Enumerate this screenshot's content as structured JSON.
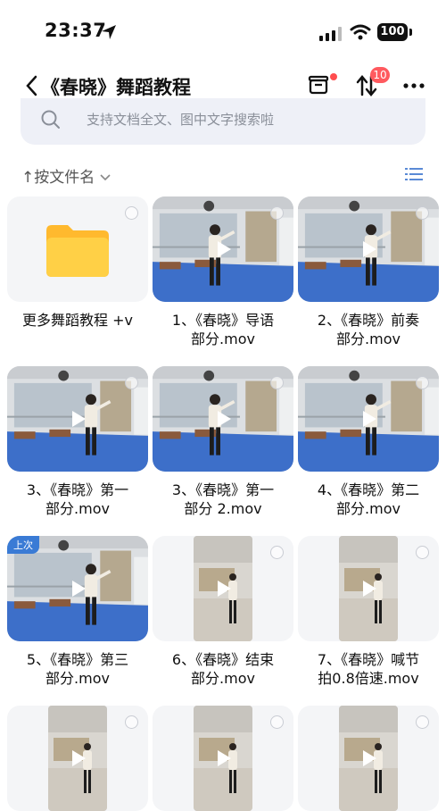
{
  "status": {
    "time": "23:37",
    "battery": "100"
  },
  "nav": {
    "title": "《春晓》舞蹈教程",
    "transfer_badge": "10"
  },
  "search": {
    "placeholder": "支持文档全文、图中文字搜索啦"
  },
  "sort": {
    "label": "按文件名"
  },
  "files": [
    {
      "name": "更多舞蹈教程 +v",
      "kind": "folder"
    },
    {
      "name": "1、《春晓》导语部分.mov",
      "kind": "video",
      "line1": "1、《春晓》导语",
      "line2": "部分.mov"
    },
    {
      "name": "2、《春晓》前奏部分.mov",
      "kind": "video",
      "line1": "2、《春晓》前奏",
      "line2": "部分.mov"
    },
    {
      "name": "3、《春晓》第一部分.mov",
      "kind": "video",
      "line1": "3、《春晓》第一",
      "line2": "部分.mov"
    },
    {
      "name": "3、《春晓》第一部分 2.mov",
      "kind": "video",
      "line1": "3、《春晓》第一",
      "line2": "部分 2.mov"
    },
    {
      "name": "4、《春晓》第二部分.mov",
      "kind": "video",
      "line1": "4、《春晓》第二",
      "line2": "部分.mov"
    },
    {
      "name": "5、《春晓》第三部分.mov",
      "kind": "video",
      "line1": "5、《春晓》第三",
      "line2": "部分.mov",
      "tag": "上次"
    },
    {
      "name": "6、《春晓》结束部分.mov",
      "kind": "video",
      "line1": "6、《春晓》结束",
      "line2": "部分.mov"
    },
    {
      "name": "7、《春晓》喊节拍0.8倍速.mov",
      "kind": "video",
      "line1": "7、《春晓》喊节",
      "line2": "拍0.8倍速.mov"
    },
    {
      "name": "",
      "kind": "video"
    },
    {
      "name": "",
      "kind": "video"
    },
    {
      "name": "",
      "kind": "video"
    }
  ],
  "colors": {
    "floor": "#3d6fc9",
    "badge": "#ff5a5f",
    "folder": "#ffc83d"
  }
}
